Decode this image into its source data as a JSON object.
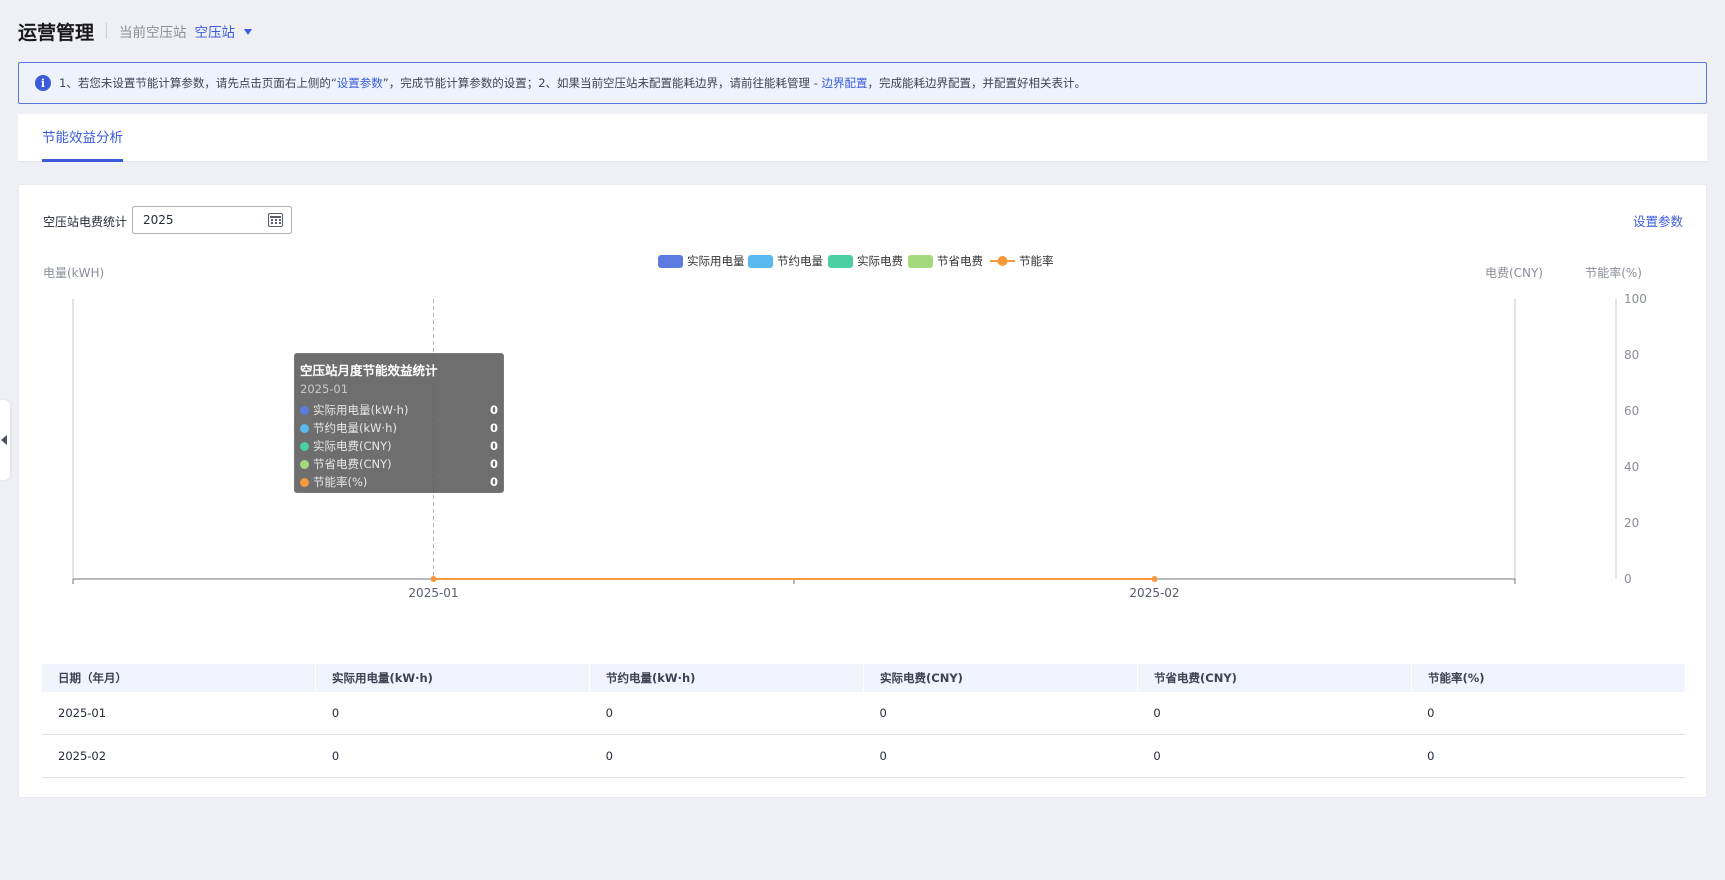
{
  "header": {
    "title": "运营管理",
    "station_label": "当前空压站",
    "station_value": "空压站"
  },
  "notice": {
    "part1": "1、若您未设置节能计算参数，请先点击页面右上侧的“",
    "link1": "设置参数",
    "part2": "”，完成节能计算参数的设置；2、如果当前空压站未配置能耗边界，请前往能耗管理 - ",
    "link2": "边界配置",
    "part3": "，完成能耗边界配置，并配置好相关表计。"
  },
  "tabs": [
    {
      "label": "节能效益分析",
      "active": true
    }
  ],
  "filter": {
    "label": "空压站电费统计",
    "year_value": "2025",
    "settings_label": "设置参数"
  },
  "chart_data": {
    "type": "bar",
    "categories": [
      "2025-01",
      "2025-02"
    ],
    "legend_position": "top-center",
    "axes": {
      "left": {
        "label": "电量(kWH)",
        "ticks": []
      },
      "right": {
        "label": "电费(CNY)",
        "ticks": []
      },
      "right2": {
        "label": "节能率(%)",
        "ticks": [
          "100",
          "80",
          "60",
          "40",
          "20",
          "0"
        ],
        "range": [
          0,
          100
        ]
      }
    },
    "series": [
      {
        "name": "实际用电量",
        "type": "bar",
        "color": "#5b7be0",
        "values": [
          0,
          0
        ]
      },
      {
        "name": "节约电量",
        "type": "bar",
        "color": "#5ab9f0",
        "values": [
          0,
          0
        ]
      },
      {
        "name": "实际电费",
        "type": "bar",
        "color": "#4ccfa3",
        "values": [
          0,
          0
        ]
      },
      {
        "name": "节省电费",
        "type": "bar",
        "color": "#a5da7c",
        "values": [
          0,
          0
        ]
      },
      {
        "name": "节能率",
        "type": "line",
        "color": "#f59a3c",
        "values": [
          0,
          0
        ]
      }
    ],
    "tooltip": {
      "title": "空压站月度节能效益统计",
      "category": "2025-01",
      "items": [
        {
          "name": "实际用电量(kW·h)",
          "color": "#5b7be0",
          "value": "0"
        },
        {
          "name": "节约电量(kW·h)",
          "color": "#5ab9f0",
          "value": "0"
        },
        {
          "name": "实际电费(CNY)",
          "color": "#4ccfa3",
          "value": "0"
        },
        {
          "name": "节省电费(CNY)",
          "color": "#a5da7c",
          "value": "0"
        },
        {
          "name": "节能率(%)",
          "color": "#f59a3c",
          "value": "0"
        }
      ]
    }
  },
  "table": {
    "headers": [
      "日期（年月）",
      "实际用电量(kW·h)",
      "节约电量(kW·h)",
      "实际电费(CNY)",
      "节省电费(CNY)",
      "节能率(%)"
    ],
    "rows": [
      [
        "2025-01",
        "0",
        "0",
        "0",
        "0",
        "0"
      ],
      [
        "2025-02",
        "0",
        "0",
        "0",
        "0",
        "0"
      ]
    ]
  }
}
